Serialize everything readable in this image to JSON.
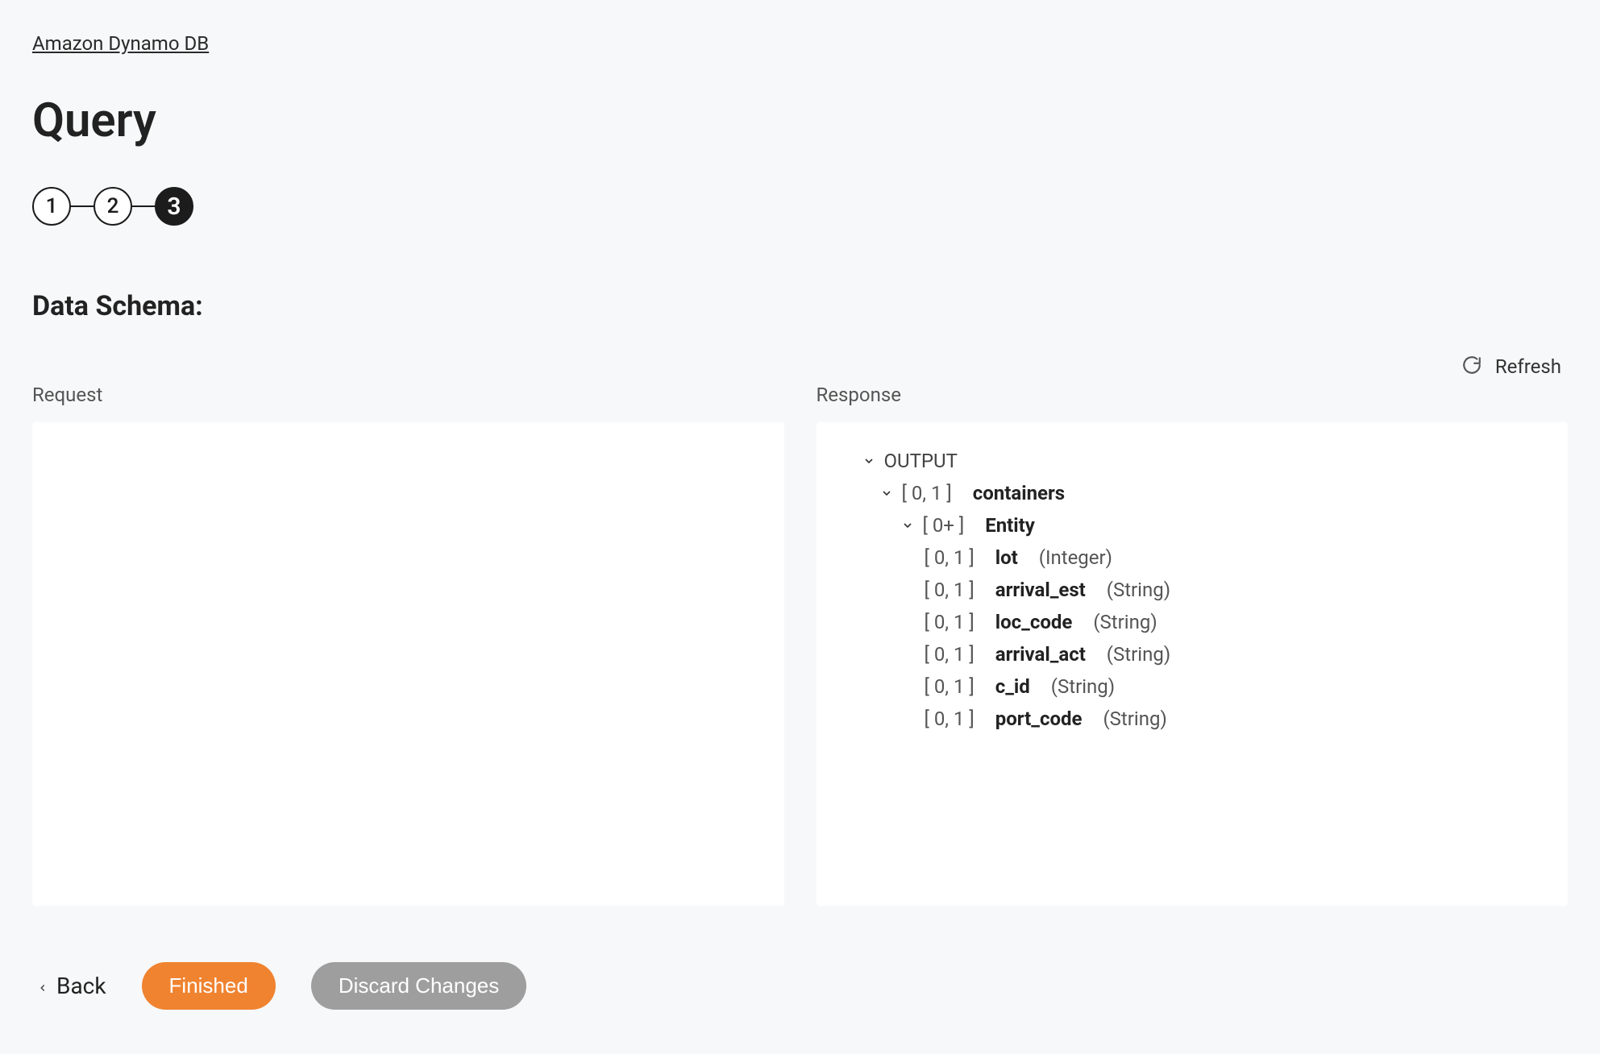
{
  "breadcrumb": {
    "label": "Amazon Dynamo DB"
  },
  "page": {
    "title": "Query"
  },
  "stepper": {
    "steps": [
      {
        "label": "1",
        "active": false
      },
      {
        "label": "2",
        "active": false
      },
      {
        "label": "3",
        "active": true
      }
    ]
  },
  "section": {
    "heading": "Data Schema:"
  },
  "refresh": {
    "label": "Refresh"
  },
  "panels": {
    "request": {
      "label": "Request"
    },
    "response": {
      "label": "Response",
      "tree": {
        "root": {
          "label": "OUTPUT"
        },
        "level1": {
          "card": "[ 0, 1 ]",
          "name": "containers"
        },
        "level2": {
          "card": "[ 0+ ]",
          "name": "Entity"
        },
        "fields": [
          {
            "card": "[ 0, 1 ]",
            "name": "lot",
            "type": "(Integer)"
          },
          {
            "card": "[ 0, 1 ]",
            "name": "arrival_est",
            "type": "(String)"
          },
          {
            "card": "[ 0, 1 ]",
            "name": "loc_code",
            "type": "(String)"
          },
          {
            "card": "[ 0, 1 ]",
            "name": "arrival_act",
            "type": "(String)"
          },
          {
            "card": "[ 0, 1 ]",
            "name": "c_id",
            "type": "(String)"
          },
          {
            "card": "[ 0, 1 ]",
            "name": "port_code",
            "type": "(String)"
          }
        ]
      }
    }
  },
  "footer": {
    "back": "Back",
    "finished": "Finished",
    "discard": "Discard Changes"
  }
}
